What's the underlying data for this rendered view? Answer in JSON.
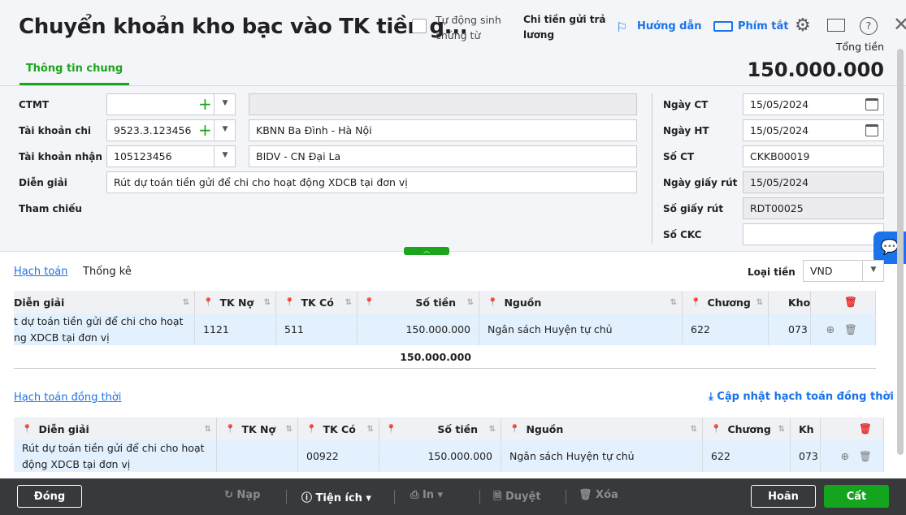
{
  "header": {
    "title": "Chuyển khoản kho bạc vào TK tiền g...",
    "auto_label": "Tự động sinh chứng từ",
    "type_label": "Chi tiền gửi trả lương",
    "guide": "Hướng dẫn",
    "shortcut": "Phím tắt",
    "total_label": "Tổng tiền",
    "total_value": "150.000.000",
    "tab": "Thông tin chung"
  },
  "form": {
    "ctmt_label": "CTMT",
    "ctmt_value": "",
    "ctmt_name": "",
    "tkchi_label": "Tài khoản chi",
    "tkchi_value": "9523.3.123456",
    "tkchi_name": "KBNN Ba Đình - Hà Nội",
    "tknhan_label": "Tài khoản nhận",
    "tknhan_value": "105123456",
    "tknhan_name": "BIDV - CN Đại La",
    "diengiai_label": "Diễn giải",
    "diengiai_value": "Rút dự toán tiền gửi để chi cho hoạt động XDCB tại đơn vị",
    "thamchieu_label": "Tham chiếu",
    "ngayct_label": "Ngày CT",
    "ngayct": "15/05/2024",
    "ngayht_label": "Ngày HT",
    "ngayht": "15/05/2024",
    "soct_label": "Số CT",
    "soct": "CKKB00019",
    "ngaygr_label": "Ngày giấy rút",
    "ngaygr": "15/05/2024",
    "sogr_label": "Số giấy rút",
    "sogr": "RDT00025",
    "sockc_label": "Số CKC",
    "sockc": ""
  },
  "tabs": {
    "hachtoan": "Hạch toán",
    "thongke": "Thống kê",
    "currency_label": "Loại tiền",
    "currency": "VND"
  },
  "grid1": {
    "headers": [
      "Diễn giải",
      "TK Nợ",
      "TK Có",
      "Số tiền",
      "Nguồn",
      "Chương",
      "Khoả"
    ],
    "row": [
      "t dự toán tiền gửi để chi cho hoạt ng XDCB tại đơn vị",
      "1121",
      "511",
      "150.000.000",
      "Ngân sách Huyện tự chủ",
      "622",
      "073"
    ],
    "total": "150.000.000"
  },
  "section2": {
    "title": "Hạch toán đồng thời",
    "update": "Cập nhật hạch toán đồng thời"
  },
  "grid2": {
    "headers": [
      "Diễn giải",
      "TK Nợ",
      "TK Có",
      "Số tiền",
      "Nguồn",
      "Chương",
      "Kh"
    ],
    "row": [
      "Rút dự toán tiền gửi để chi cho hoạt động XDCB tại đơn vị",
      "",
      "00922",
      "150.000.000",
      "Ngân sách Huyện tự chủ",
      "622",
      "073"
    ]
  },
  "footer": {
    "close": "Đóng",
    "reload": "Nạp",
    "utility": "Tiện ích",
    "print": "In",
    "approve": "Duyệt",
    "delete": "Xóa",
    "postpone": "Hoãn",
    "save": "Cất"
  }
}
